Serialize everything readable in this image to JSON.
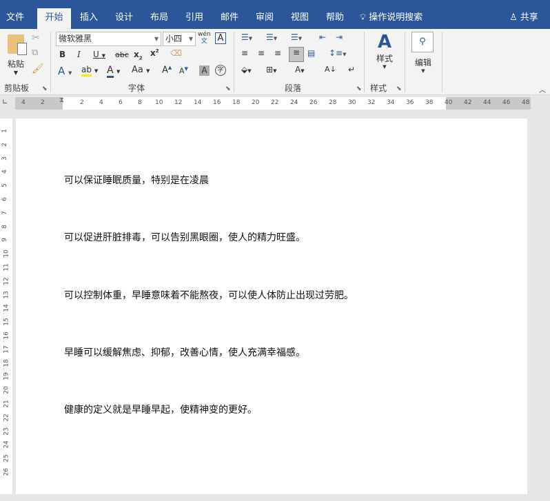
{
  "tabs": [
    {
      "label": "文件"
    },
    {
      "label": "开始",
      "active": true
    },
    {
      "label": "插入"
    },
    {
      "label": "设计"
    },
    {
      "label": "布局"
    },
    {
      "label": "引用"
    },
    {
      "label": "邮件"
    },
    {
      "label": "审阅"
    },
    {
      "label": "视图"
    },
    {
      "label": "帮助"
    }
  ],
  "tell_me": "操作说明搜索",
  "share": "共享",
  "ribbon": {
    "clipboard": {
      "paste": "粘贴",
      "label": "剪贴板"
    },
    "font": {
      "name": "微软雅黑",
      "size": "小四",
      "label": "字体",
      "phonetic": "wén",
      "change_case": "Aa"
    },
    "paragraph": {
      "label": "段落"
    },
    "styles": {
      "button": "样式",
      "label": "样式"
    },
    "editing": {
      "button": "编辑"
    }
  },
  "colors": {
    "accent": "#2b579a",
    "highlight": "#ffe600",
    "font_color": "#2b579a"
  },
  "hruler": {
    "left": [
      "4",
      "2"
    ],
    "right": [
      "2",
      "4",
      "6",
      "8",
      "10",
      "12",
      "14",
      "16",
      "18",
      "20",
      "22",
      "24",
      "26",
      "28",
      "30",
      "32",
      "34",
      "36",
      "38",
      "40",
      "42",
      "44",
      "46",
      "48"
    ]
  },
  "vruler": [
    "1",
    "2",
    "3",
    "4",
    "5",
    "6",
    "7",
    "8",
    "9",
    "10",
    "11",
    "12",
    "13",
    "14",
    "15",
    "16",
    "17",
    "18",
    "19",
    "20",
    "21",
    "22",
    "23",
    "24",
    "25",
    "26"
  ],
  "document": {
    "lines": [
      "可以保证睡眠质量，特别是在凌晨",
      "可以促进肝脏排毒，可以告别黑眼圈，使人的精力旺盛。",
      "可以控制体重，早睡意味着不能熬夜，可以使人体防止出现过劳肥。",
      "早睡可以缓解焦虑、抑郁，改善心情，使人充满幸福感。",
      "健康的定义就是早睡早起，使精神变的更好。"
    ]
  }
}
